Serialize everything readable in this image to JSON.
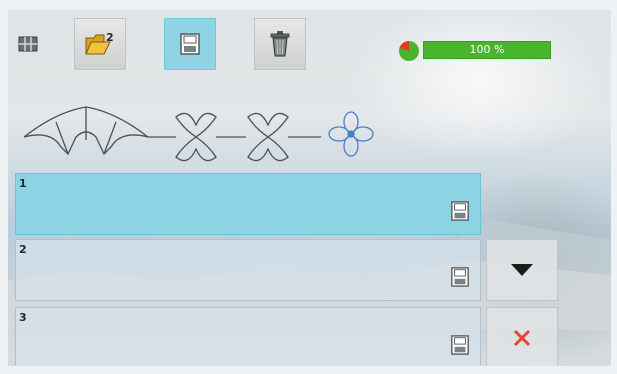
{
  "toolbar": {
    "buttons": [
      {
        "id": "grid",
        "icon": "grid-icon",
        "active": false
      },
      {
        "id": "open",
        "icon": "folder-open-icon",
        "badge": "2",
        "active": false
      },
      {
        "id": "save",
        "icon": "memory-icon",
        "active": true
      },
      {
        "id": "delete",
        "icon": "trash-icon",
        "active": false
      }
    ]
  },
  "progress": {
    "value": 1.0,
    "label": "100 %",
    "colors": {
      "fill": "#49b52e",
      "track": "#b5d7a2",
      "pie": "#49b52e",
      "pie_rest": "#e23a2a"
    }
  },
  "stitch_preview": {
    "motifs": [
      "fan-motif",
      "butterfly-motif",
      "butterfly-motif",
      "flower-motif"
    ]
  },
  "slots": [
    {
      "number": "1",
      "icon": "memory-icon",
      "selected": true
    },
    {
      "number": "2",
      "icon": "memory-icon",
      "selected": false
    },
    {
      "number": "3",
      "icon": "memory-icon",
      "selected": false
    }
  ],
  "side_buttons": [
    {
      "id": "scroll-down",
      "icon": "triangle-down-icon"
    },
    {
      "id": "close",
      "icon": "close-x-icon",
      "color": "#e8432e"
    }
  ],
  "colors": {
    "accent": "#8dd3e4",
    "close": "#e8432e"
  }
}
